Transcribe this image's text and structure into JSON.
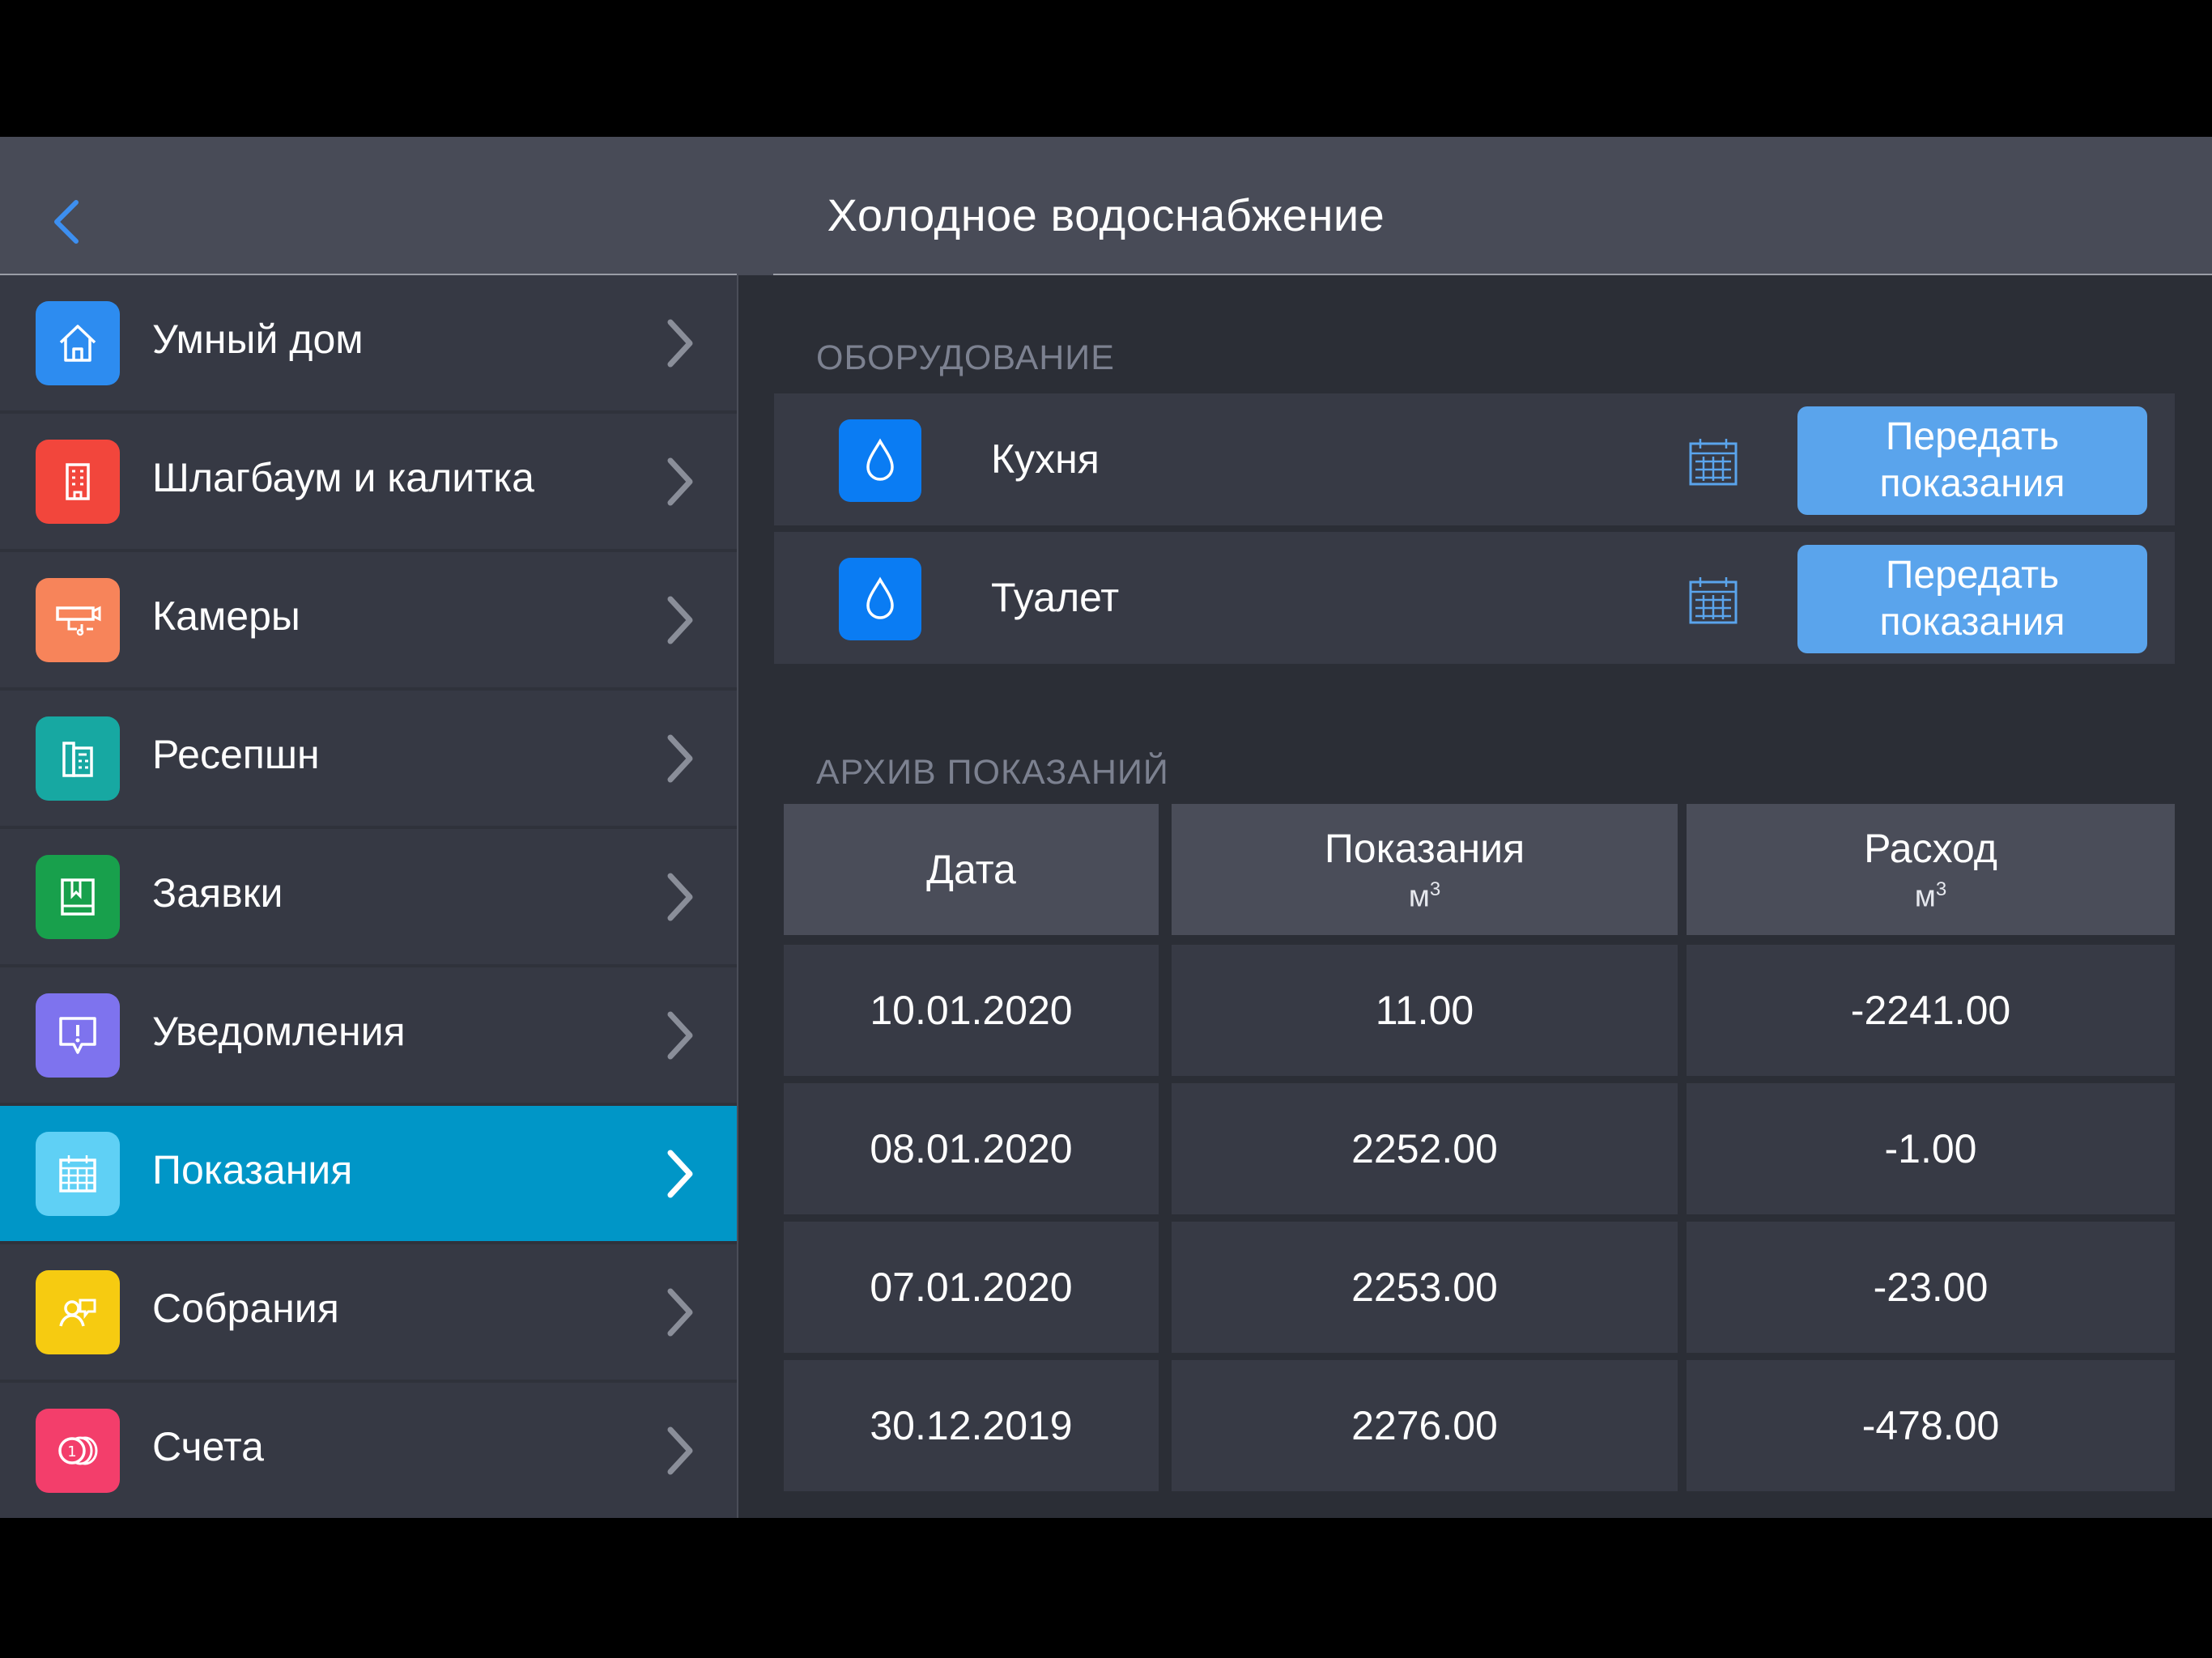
{
  "header": {
    "title": "Холодное водоснабжение",
    "back_icon": "chevron-left-icon"
  },
  "sidebar": {
    "items": [
      {
        "label": "Умный дом",
        "icon": "smart-home-icon",
        "color": "#2d8cf0",
        "active": false
      },
      {
        "label": "Шлагбаум и калитка",
        "icon": "building-icon",
        "color": "#f2463c",
        "active": false
      },
      {
        "label": "Камеры",
        "icon": "camera-icon",
        "color": "#f7845a",
        "active": false
      },
      {
        "label": "Ресепшн",
        "icon": "reception-icon",
        "color": "#17a8a2",
        "active": false
      },
      {
        "label": "Заявки",
        "icon": "book-icon",
        "color": "#18a04c",
        "active": false
      },
      {
        "label": "Уведомления",
        "icon": "notification-icon",
        "color": "#7e73ee",
        "active": false
      },
      {
        "label": "Показания",
        "icon": "calendar-icon",
        "color": "#5fd0f5",
        "active": true
      },
      {
        "label": "Собрания",
        "icon": "meeting-icon",
        "color": "#f6cb11",
        "active": false
      },
      {
        "label": "Счета",
        "icon": "coins-icon",
        "color": "#f33e6b",
        "active": false
      }
    ]
  },
  "equipment": {
    "section_label": "ОБОРУДОВАНИЕ",
    "items": [
      {
        "name": "Кухня",
        "button_line1": "Передать",
        "button_line2": "показания"
      },
      {
        "name": "Туалет",
        "button_line1": "Передать",
        "button_line2": "показания"
      }
    ]
  },
  "archive": {
    "section_label": "АРХИВ ПОКАЗАНИЙ",
    "columns": [
      {
        "title": "Дата",
        "unit": ""
      },
      {
        "title": "Показания",
        "unit": "м",
        "unit_sup": "3"
      },
      {
        "title": "Расход",
        "unit": "м",
        "unit_sup": "3"
      }
    ],
    "rows": [
      [
        "10.01.2020",
        "11.00",
        "-2241.00"
      ],
      [
        "08.01.2020",
        "2252.00",
        "-1.00"
      ],
      [
        "07.01.2020",
        "2253.00",
        "-23.00"
      ],
      [
        "30.12.2019",
        "2276.00",
        "-478.00"
      ]
    ]
  },
  "colors": {
    "accent": "#0096c7",
    "button": "#5aa4ec",
    "drop_icon_bg": "#0a7cf3",
    "back_arrow": "#3d8ff0"
  }
}
